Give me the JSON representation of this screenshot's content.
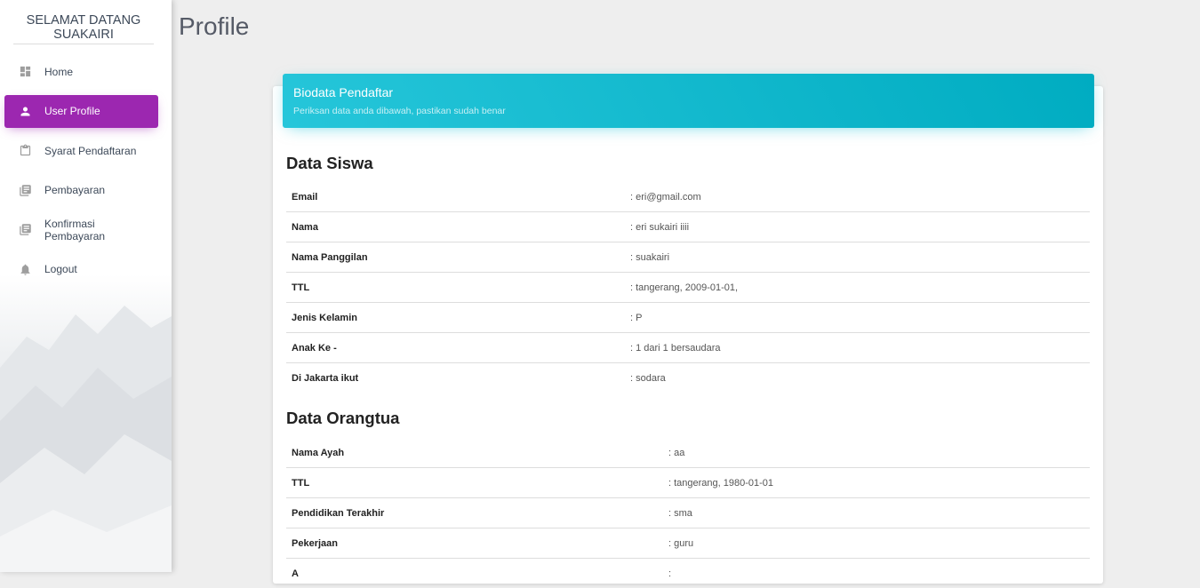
{
  "sidebar": {
    "brand": "SELAMAT DATANG SUAKAIRI",
    "items": [
      {
        "label": "Home",
        "icon": "dashboard-icon",
        "active": false
      },
      {
        "label": "User Profile",
        "icon": "person-icon",
        "active": true
      },
      {
        "label": "Syarat Pendaftaran",
        "icon": "clipboard-icon",
        "active": false
      },
      {
        "label": "Pembayaran",
        "icon": "library-books-icon",
        "active": false
      },
      {
        "label": "Konfirmasi Pembayaran",
        "icon": "library-books-icon",
        "active": false
      },
      {
        "label": "Logout",
        "icon": "bell-icon",
        "active": false
      }
    ]
  },
  "page": {
    "title": "Profile"
  },
  "card": {
    "title": "Biodata Pendaftar",
    "subtitle": "Periksan data anda dibawah, pastikan sudah benar"
  },
  "siswa": {
    "title": "Data Siswa",
    "rows": [
      {
        "key": "Email",
        "value": ": eri@gmail.com"
      },
      {
        "key": "Nama",
        "value": ": eri sukairi iiii"
      },
      {
        "key": "Nama Panggilan",
        "value": ": suakairi"
      },
      {
        "key": "TTL",
        "value": ": tangerang, 2009-01-01,"
      },
      {
        "key": "Jenis Kelamin",
        "value": ": P"
      },
      {
        "key": "Anak Ke -",
        "value": ": 1 dari 1 bersaudara"
      },
      {
        "key": "Di Jakarta ikut",
        "value": ": sodara"
      }
    ]
  },
  "orangtua": {
    "title": "Data Orangtua",
    "rows": [
      {
        "key": "Nama Ayah",
        "value": ": aa"
      },
      {
        "key": "TTL",
        "value": ": tangerang, 1980-01-01"
      },
      {
        "key": "Pendidikan Terakhir",
        "value": ": sma"
      },
      {
        "key": "Pekerjaan",
        "value": ": guru"
      },
      {
        "key": "A",
        "value": ": "
      }
    ]
  },
  "colors": {
    "active": "#9c27b0",
    "header": "#00acc1",
    "background": "#eeeeee"
  }
}
